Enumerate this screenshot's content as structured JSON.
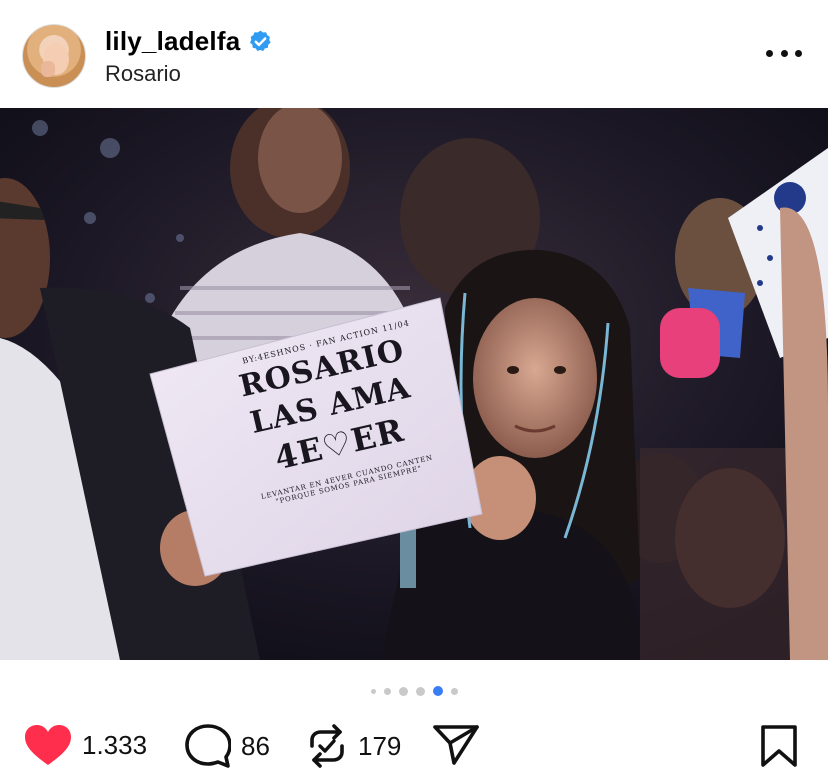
{
  "post": {
    "username": "lily_ladelfa",
    "location": "Rosario",
    "verified": true
  },
  "sign": {
    "top_line": "BY:4ESHNOS · FAN ACTION 11/04",
    "line1": "ROSARIO",
    "line2": "LAS AMA",
    "line3": "4E♡ER",
    "bottom_line1": "LEVANTAR EN 4EVER CUANDO CANTEN",
    "bottom_line2": "\"PORQUE SOMOS PARA SIEMPRE\""
  },
  "carousel": {
    "total_dots": 6,
    "active_index": 4
  },
  "actions": {
    "likes": "1.333",
    "comments": "86",
    "reposts": "179"
  },
  "colors": {
    "like": "#ff2e4d",
    "active_dot": "#3a7ef5",
    "inactive_dot": "#c9c9c9",
    "verified": "#2f9bf2"
  },
  "icons": [
    "verified-badge-icon",
    "more-options-icon",
    "heart-icon",
    "comment-icon",
    "repost-icon",
    "share-icon",
    "bookmark-icon"
  ]
}
